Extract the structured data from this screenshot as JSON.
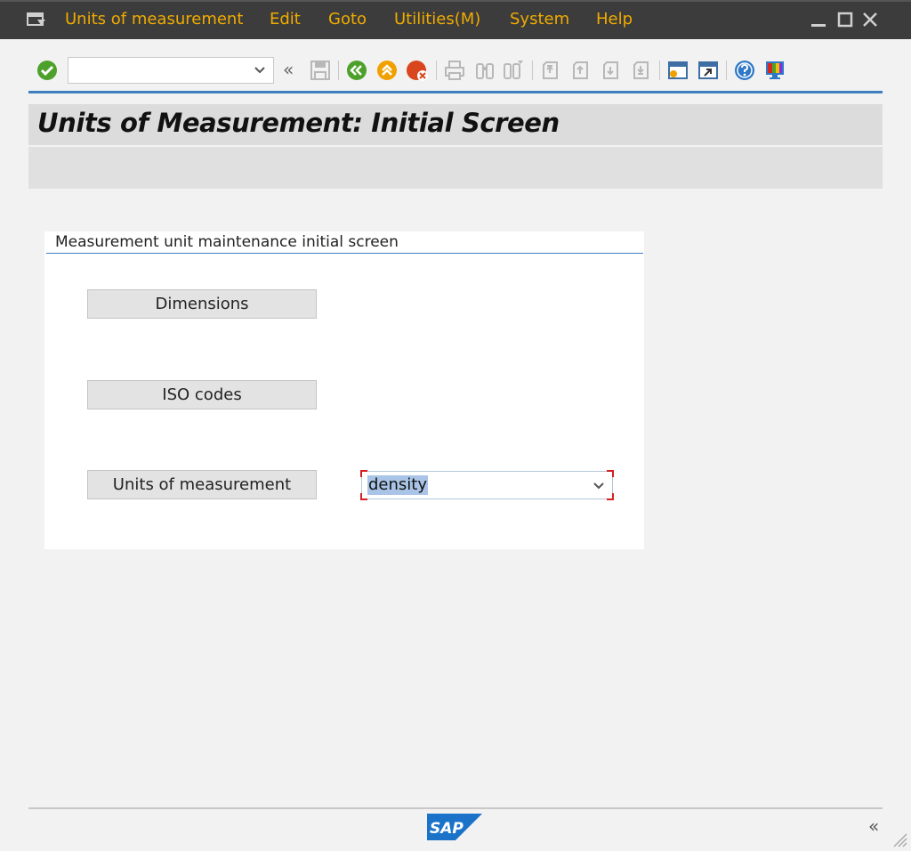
{
  "menubar": {
    "items": [
      {
        "label": "Units of measurement"
      },
      {
        "label": "Edit"
      },
      {
        "label": "Goto"
      },
      {
        "label": "Utilities(M)"
      },
      {
        "label": "System"
      },
      {
        "label": "Help"
      }
    ]
  },
  "toolbar": {
    "command_field_value": "",
    "icons": [
      "enter-icon",
      "save-icon",
      "back-icon",
      "exit-icon",
      "cancel-icon",
      "print-icon",
      "find-icon",
      "find-next-icon",
      "first-page-icon",
      "previous-page-icon",
      "next-page-icon",
      "last-page-icon",
      "create-session-icon",
      "shortcut-icon",
      "help-icon",
      "customize-layout-icon"
    ]
  },
  "title": "Units of Measurement: Initial Screen",
  "group": {
    "title": "Measurement unit maintenance initial screen",
    "buttons": {
      "dimensions": "Dimensions",
      "iso_codes": "ISO codes",
      "units": "Units of measurement"
    },
    "dimension_select_value": "density"
  },
  "footer": {
    "logo_text": "SAP"
  },
  "colors": {
    "menubar_bg": "#3c3c3c",
    "menu_text": "#f0ab00",
    "accent_line": "#3d7fc1",
    "sap_blue": "#1a73c9"
  }
}
